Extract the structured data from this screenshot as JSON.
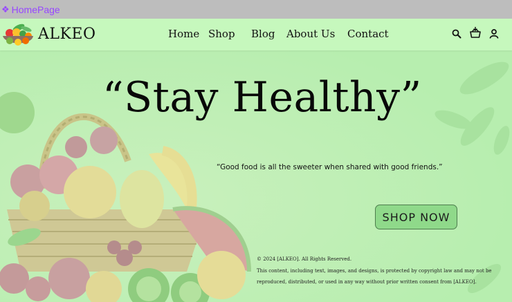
{
  "frame": {
    "label": "HomePage",
    "icon": "frame-icon"
  },
  "header": {
    "brand": "ALKEO",
    "logo_icon": "fruit-bowl-logo-icon",
    "nav": [
      {
        "label": "Home"
      },
      {
        "label": "Shop"
      },
      {
        "label": "Blog"
      },
      {
        "label": "About Us"
      },
      {
        "label": "Contact"
      }
    ],
    "icons": [
      "search-icon",
      "cart-icon",
      "account-icon"
    ]
  },
  "hero": {
    "headline": "“Stay Healthy”",
    "quote": "“Good food is all the sweeter when shared with good friends.”",
    "cta_label": "SHOP NOW",
    "background_image": "fruit-basket-image"
  },
  "footer": {
    "copyright": "© 2024 [ALKEO]. All Rights Reserved.",
    "notice_line1": "This content, including text, images, and designs, is protected by copyright law and may not be",
    "notice_line2": "reproduced, distributed, or used in any way without prior written consent from [ALKEO]."
  },
  "colors": {
    "page_bg": "#b9efb0",
    "header_bg": "#c6f8bd",
    "button_bg": "#8fd98a",
    "frame_label": "#9747ff"
  }
}
